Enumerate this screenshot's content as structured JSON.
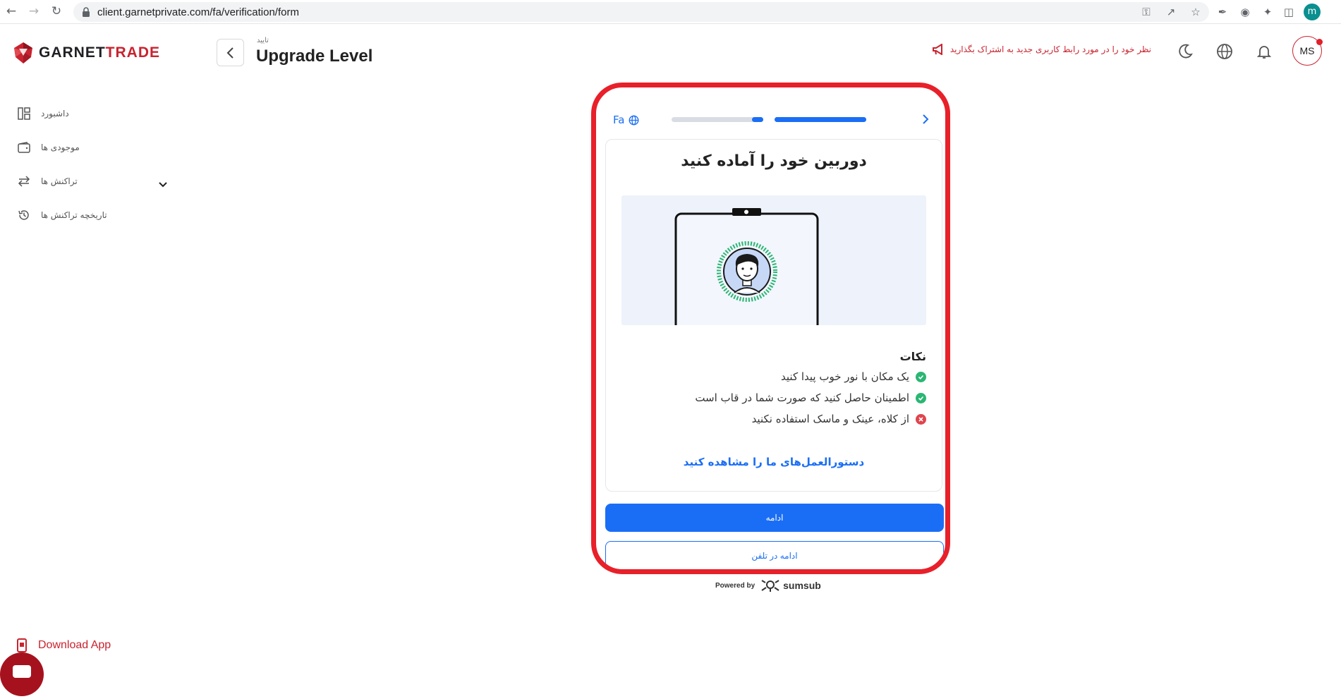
{
  "browser": {
    "url": "client.garnetprivate.com/fa/verification/form",
    "profile_initial": "m"
  },
  "brand": {
    "name_part1": "GARNET",
    "name_part2": "TRADE",
    "accent_color": "#c9232f"
  },
  "sidebar": {
    "items": [
      {
        "label": "داشبورد",
        "icon": "dashboard-icon"
      },
      {
        "label": "موجودی ها",
        "icon": "wallet-icon"
      },
      {
        "label": "تراکنش ها",
        "icon": "transfer-icon"
      },
      {
        "label": "تاریخچه تراکنش ها",
        "icon": "history-icon"
      }
    ],
    "download_label": "Download App"
  },
  "header": {
    "breadcrumb": "تایید",
    "title": "Upgrade Level",
    "announcement": "نظر خود را در مورد رابط کاربری جدید به اشتراک بگذارید",
    "user_initials": "MS"
  },
  "verification": {
    "language": "Fa",
    "progress_first": 0.12,
    "progress_second": 1.0,
    "title": "دوربین خود را آماده کنید",
    "tips_title": "نکات",
    "tips": [
      {
        "text": "یک مکان با نور خوب پیدا کنید",
        "status": "ok"
      },
      {
        "text": "اطمینان حاصل کنید که صورت شما در قاب است",
        "status": "ok"
      },
      {
        "text": "از کلاه، عینک و ماسک استفاده نکنید",
        "status": "bad"
      }
    ],
    "guide_link": "دستورالعمل‌های ما را مشاهده کنید",
    "continue_label": "ادامه",
    "continue_phone_label": "ادامه در تلفن",
    "powered_by": "Powered by",
    "provider": "sumsub",
    "primary_color": "#1a6ef5",
    "ok_color": "#2bb673",
    "bad_color": "#e0444d"
  }
}
